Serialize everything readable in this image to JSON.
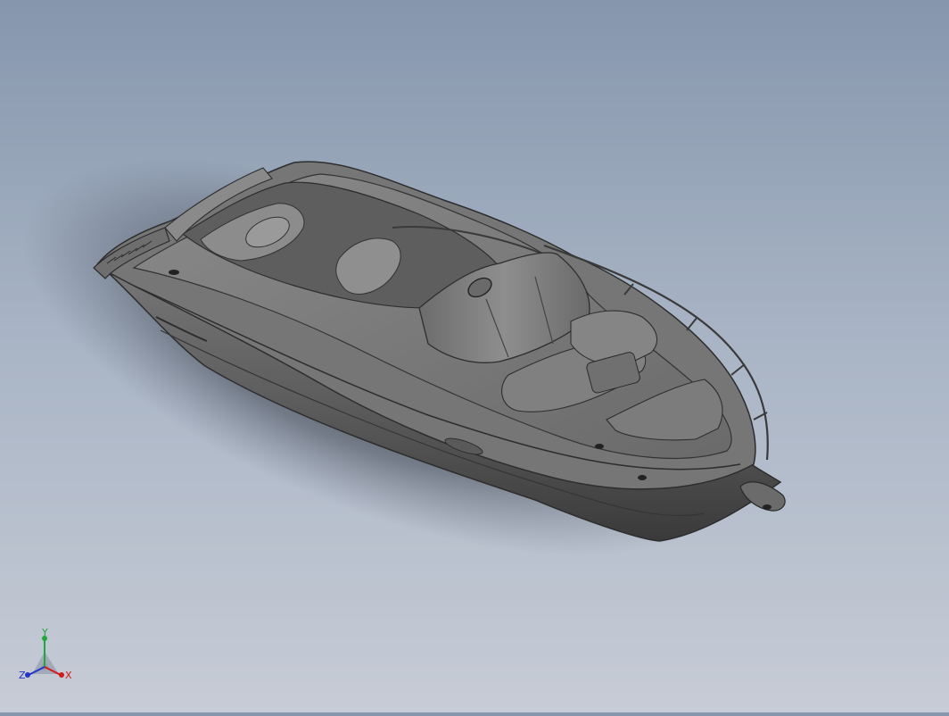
{
  "viewport": {
    "model_name": "motor-yacht-hull",
    "background_top": "#8696ad",
    "background_bottom": "#c7ccd6"
  },
  "triad": {
    "x_label": "X",
    "y_label": "Y",
    "z_label": "Z",
    "x_color": "#d11a1a",
    "y_color": "#1ea83a",
    "z_color": "#2235c8"
  }
}
